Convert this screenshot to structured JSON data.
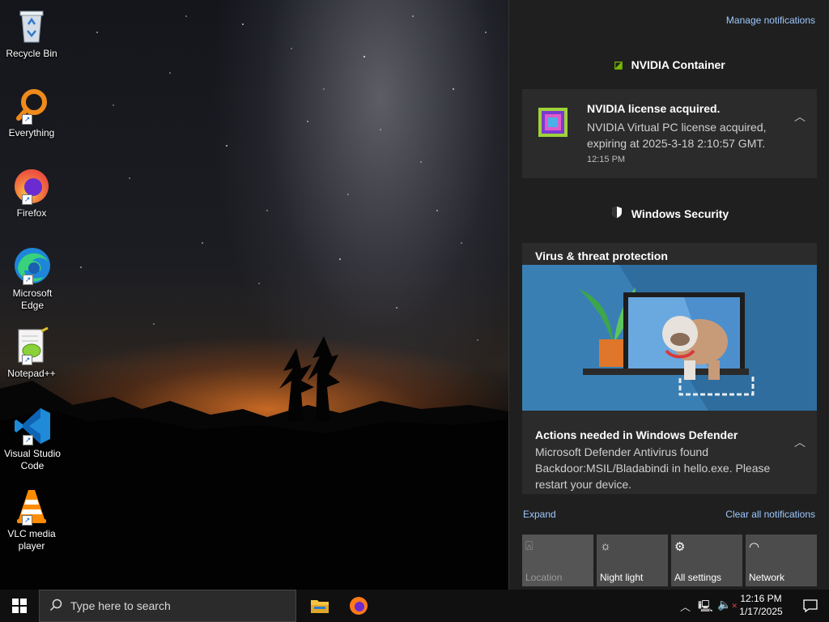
{
  "desktop": {
    "icons": [
      {
        "label": "Recycle Bin",
        "icon": "recycle-bin-icon"
      },
      {
        "label": "Everything",
        "icon": "everything-icon"
      },
      {
        "label": "Firefox",
        "icon": "firefox-icon"
      },
      {
        "label": "Microsoft Edge",
        "icon": "edge-icon"
      },
      {
        "label": "Notepad++",
        "icon": "notepadpp-icon"
      },
      {
        "label": "Visual Studio Code",
        "icon": "vscode-icon"
      },
      {
        "label": "VLC media player",
        "icon": "vlc-icon"
      }
    ]
  },
  "action_center": {
    "manage_label": "Manage notifications",
    "nvidia_group": "NVIDIA Container",
    "nvidia_notif": {
      "title": "NVIDIA license acquired.",
      "body": "NVIDIA Virtual PC license acquired, expiring at 2025-3-18 2:10:57 GMT.",
      "time": "12:15 PM"
    },
    "security_group": "Windows Security",
    "virus_title": "Virus & threat protection",
    "defender_notif": {
      "title": "Actions needed in Windows Defender",
      "body": "Microsoft Defender Antivirus found Backdoor:MSIL/Bladabindi in hello.exe. Please restart your device."
    },
    "expand_label": "Expand",
    "clear_label": "Clear all notifications",
    "quick_actions": [
      {
        "label": "Location",
        "icon": "location-icon",
        "active": false
      },
      {
        "label": "Night light",
        "icon": "night-light-icon",
        "active": true
      },
      {
        "label": "All settings",
        "icon": "settings-icon",
        "active": true
      },
      {
        "label": "Network",
        "icon": "network-icon",
        "active": true
      }
    ]
  },
  "taskbar": {
    "search_placeholder": "Type here to search",
    "time": "12:16 PM",
    "date": "1/17/2025"
  },
  "colors": {
    "accent_link": "#9ec8ff",
    "card_bg": "#2b2b2b",
    "panel_bg": "#1f1f1f",
    "illustration_bg": "#2e6d9e"
  }
}
